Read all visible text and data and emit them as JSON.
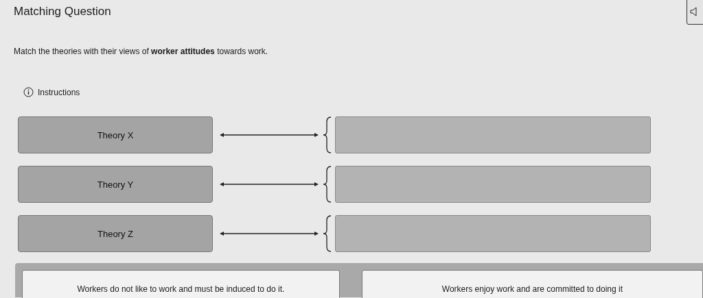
{
  "title": "Matching Question",
  "prompt": "Match the theories with their views of **worker attitudes** towards work.",
  "instructions": "Instructions",
  "rows": [
    {
      "label": "Theory X"
    },
    {
      "label": "Theory Y"
    },
    {
      "label": "Theory Z"
    }
  ],
  "answer_choices": [
    "Workers do not like to work and must be induced to do it.",
    "Workers enjoy work and are committed to doing it"
  ]
}
